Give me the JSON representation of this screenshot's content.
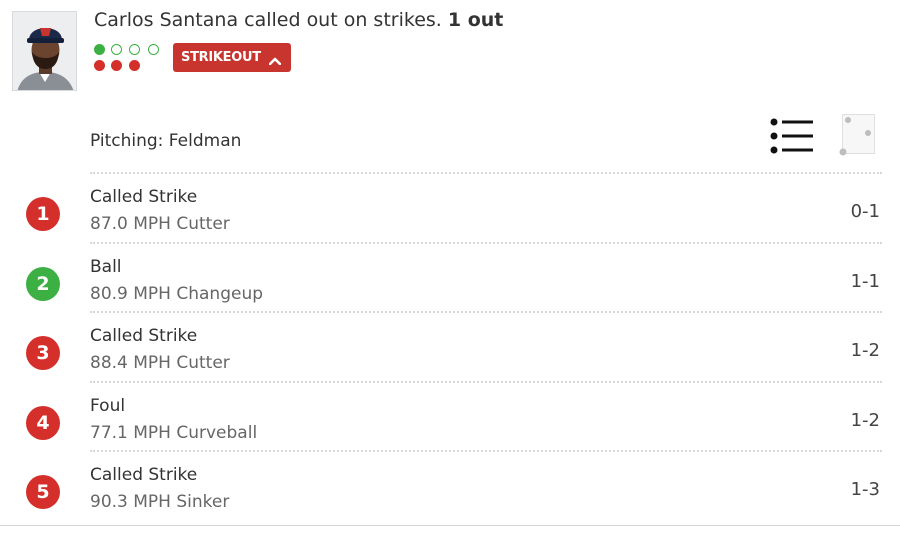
{
  "play": {
    "description": "Carlos Santana called out on strikes.",
    "outs": "1 out",
    "badge": "STRIKEOUT",
    "balls_shown": 1,
    "strikes_shown": 3
  },
  "pitcher": {
    "label": "Pitching: Feldman"
  },
  "colors": {
    "strike": "#d42f2a",
    "ball": "#3cb043",
    "badge": "#c7352e"
  },
  "pitches": [
    {
      "num": "1",
      "result": "Called Strike",
      "pitch": "87.0 MPH Cutter",
      "count": "0-1",
      "type": "strike"
    },
    {
      "num": "2",
      "result": "Ball",
      "pitch": "80.9 MPH Changeup",
      "count": "1-1",
      "type": "ball"
    },
    {
      "num": "3",
      "result": "Called Strike",
      "pitch": "88.4 MPH Cutter",
      "count": "1-2",
      "type": "strike"
    },
    {
      "num": "4",
      "result": "Foul",
      "pitch": "77.1 MPH Curveball",
      "count": "1-2",
      "type": "strike"
    },
    {
      "num": "5",
      "result": "Called Strike",
      "pitch": "90.3 MPH Sinker",
      "count": "1-3",
      "type": "strike"
    }
  ]
}
